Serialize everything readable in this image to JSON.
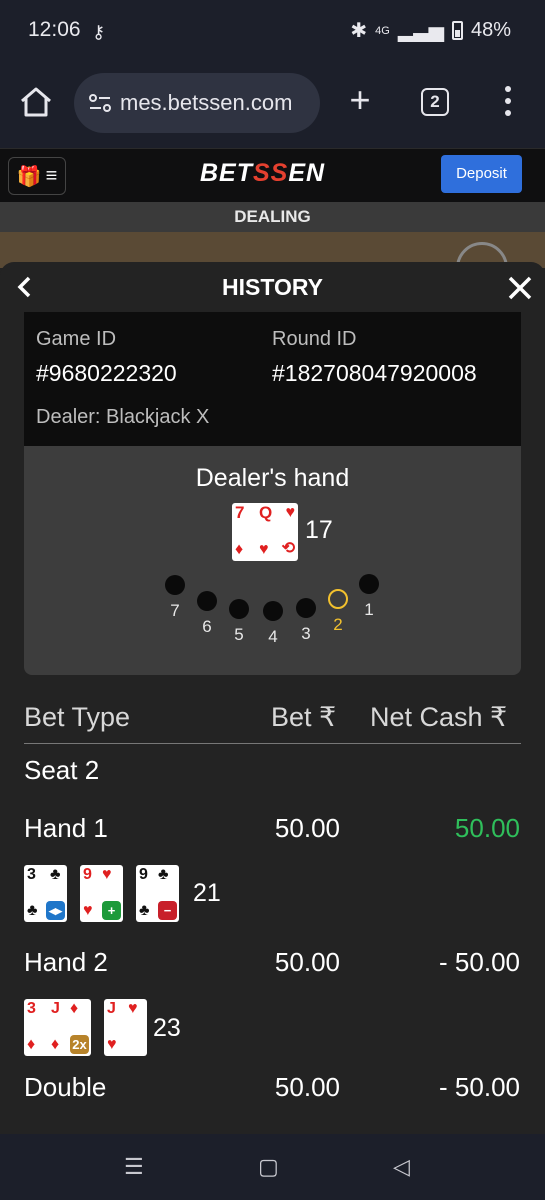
{
  "status": {
    "time": "12:06",
    "network": "4G",
    "battery": "48%"
  },
  "browser": {
    "url": "mes.betssen.com",
    "tab_count": "2"
  },
  "site": {
    "logo_a": "BET",
    "logo_b": "SS",
    "logo_c": "EN",
    "deposit_label": "Deposit"
  },
  "banner": {
    "dealing": "DEALING"
  },
  "history": {
    "title": "HISTORY",
    "game_id_label": "Game ID",
    "game_id": "#9680222320",
    "round_id_label": "Round ID",
    "round_id": "#182708047920008",
    "dealer": "Dealer: Blackjack X",
    "dealer_hand_title": "Dealer's hand",
    "dealer_total": "17",
    "dealer_cards": [
      {
        "rank": "7",
        "suit": "♦"
      },
      {
        "rank": "Q",
        "suit": "♥"
      }
    ],
    "seats": [
      "7",
      "6",
      "5",
      "4",
      "3",
      "2",
      "1"
    ],
    "active_seat": "2"
  },
  "table": {
    "headers": {
      "bet_type": "Bet Type",
      "bet": "Bet ₹",
      "net_cash": "Net Cash ₹"
    },
    "seat_label": "Seat 2",
    "rows": [
      {
        "type": "Hand 1",
        "bet": "50.00",
        "net": "50.00",
        "total": "21"
      },
      {
        "type": "Hand 2",
        "bet": "50.00",
        "net": "- 50.00",
        "total": "23"
      },
      {
        "type": "Double",
        "bet": "50.00",
        "net": "- 50.00"
      }
    ],
    "hand1_cards": [
      {
        "rank": "3",
        "suit": "♣",
        "badge": "split"
      },
      {
        "rank": "9",
        "suit": "♥",
        "badge": "hit"
      },
      {
        "rank": "9",
        "suit": "♣",
        "badge": "stand"
      }
    ],
    "hand2_cards": [
      {
        "rank": "3",
        "suit": "♦"
      },
      {
        "rank": "J",
        "suit": "♦",
        "badge": "2x"
      },
      {
        "rank": "J",
        "suit": "♥"
      }
    ]
  },
  "colors": {
    "deposit": "#2f6fdc",
    "win": "#2fbf5b",
    "active_seat": "#f2c12e",
    "logo_accent": "#e5402f"
  }
}
